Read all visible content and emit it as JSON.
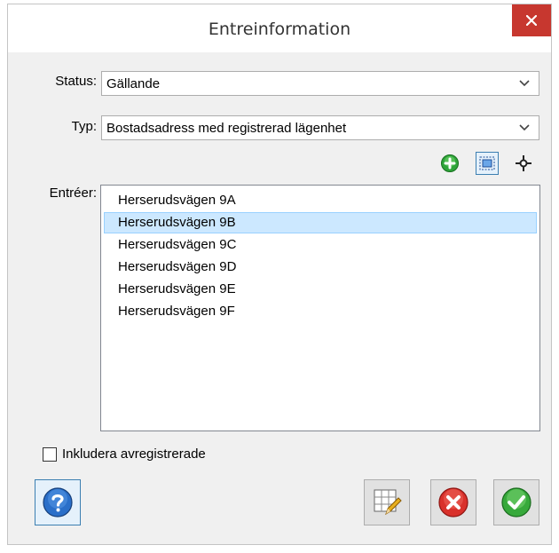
{
  "window": {
    "title": "Entreinformation"
  },
  "form": {
    "status_label": "Status:",
    "status_value": "Gällande",
    "type_label": "Typ:",
    "type_value": "Bostadsadress med registrerad lägenhet",
    "entries_label": "Entréer:"
  },
  "entries": [
    {
      "label": "Herserudsvägen 9A",
      "selected": false
    },
    {
      "label": "Herserudsvägen 9B",
      "selected": true
    },
    {
      "label": "Herserudsvägen 9C",
      "selected": false
    },
    {
      "label": "Herserudsvägen 9D",
      "selected": false
    },
    {
      "label": "Herserudsvägen 9E",
      "selected": false
    },
    {
      "label": "Herserudsvägen 9F",
      "selected": false
    }
  ],
  "toolbar_icons": [
    "add-icon",
    "select-area-icon",
    "locate-crosshair-icon"
  ],
  "include_deregistered": {
    "label": "Inkludera avregistrerade",
    "checked": false
  },
  "buttons": [
    "help-icon",
    "edit-table-icon",
    "cancel-icon",
    "ok-icon"
  ],
  "colors": {
    "close": "#c7372f",
    "selection": "#cce8ff",
    "selection_border": "#99d1ff",
    "focus": "#3c7fb1"
  }
}
